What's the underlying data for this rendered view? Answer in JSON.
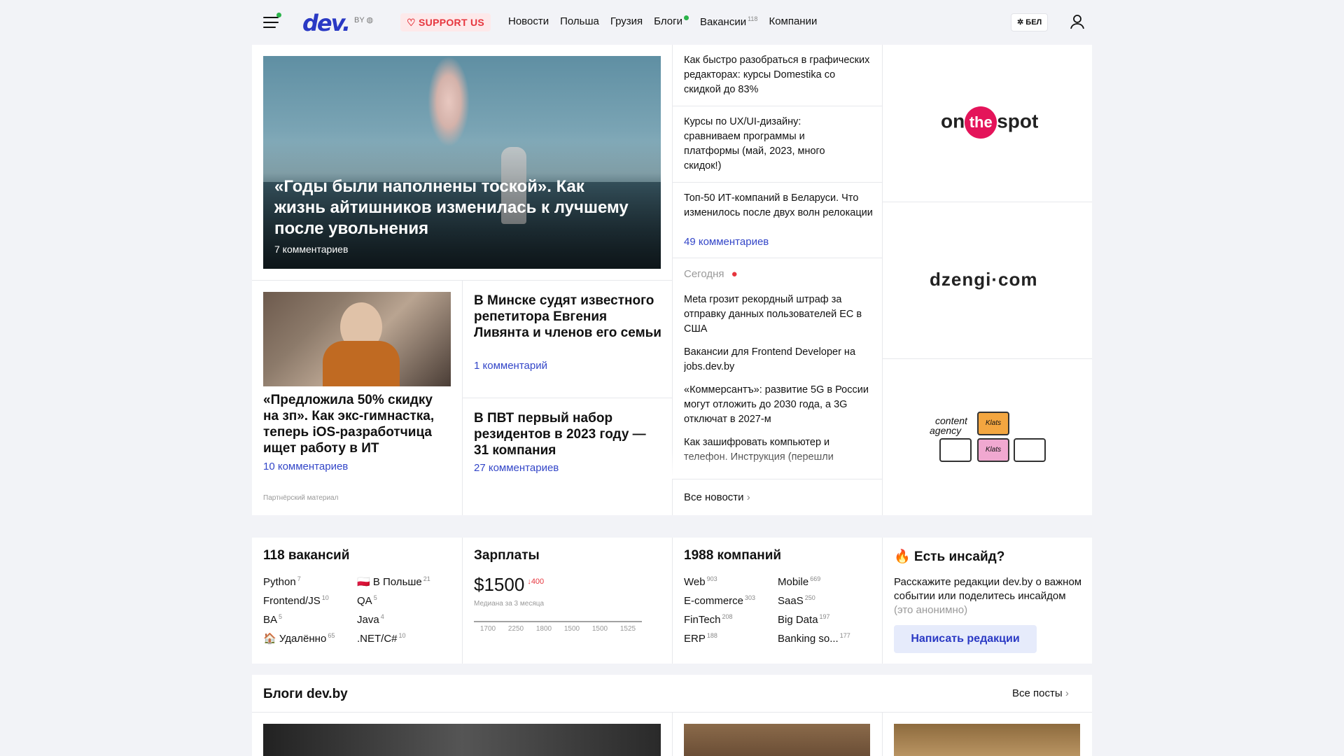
{
  "header": {
    "logo": "dev.",
    "region": "BY",
    "support": "♡ SUPPORT US",
    "nav": [
      {
        "label": "Новости"
      },
      {
        "label": "Польша"
      },
      {
        "label": "Грузия"
      },
      {
        "label": "Блоги",
        "dot": true
      },
      {
        "label": "Вакансии",
        "count": "118"
      },
      {
        "label": "Компании"
      }
    ],
    "lang": "БЕЛ"
  },
  "hero": {
    "title": "«Годы были наполнены тоской». Как жизнь айтишников изменилась к лучшему после увольнения",
    "comments": "7 комментариев"
  },
  "story_left": {
    "title": "«Предложила 50% скидку на зп». Как экс-гимнастка, теперь iOS-разработчица ищет работу в ИТ",
    "comments": "10 комментариев",
    "partner": "Партнёрский материал"
  },
  "story_mid1": {
    "title": "В Минске судят известного репетитора Евгения Ливянта и членов его семьи",
    "comments": "1 комментарий"
  },
  "story_mid2": {
    "title": "В ПВТ первый набор резидентов в 2023 году — 31 компания",
    "comments": "27 комментариев"
  },
  "side_top": [
    {
      "title": "Как быстро разобраться в графических редакторах: курсы Domestika со скидкой до 83%"
    },
    {
      "title": "Курсы по UX/UI-дизайну: сравниваем программы и платформы (май, 2023, много скидок!)"
    },
    {
      "title": "Топ-50 ИТ-компаний в Беларуси. Что изменилось после двух волн релокации",
      "comments": "49 комментариев"
    }
  ],
  "today": {
    "label": "Сегодня",
    "items": [
      "Meta грозит рекордный штраф за отправку данных пользователей ЕС в США",
      "Вакансии для Frontend Developer на jobs.dev.by",
      "«Коммерсантъ»: развитие 5G в России могут отложить до 2030 года, а 3G отключат в 2027-м",
      "Как зашифровать компьютер и телефон. Инструкция (перешли"
    ],
    "all_news": "Все новости"
  },
  "ads": {
    "a1": {
      "pre": "on",
      "mid": "the",
      "post": "spot"
    },
    "a2": "dzengi·com",
    "a3": {
      "line1": "content",
      "line2": "agency",
      "brand": "Klats"
    }
  },
  "vacancies": {
    "title": "118 вакансий",
    "tags": [
      {
        "label": "Python",
        "count": "7"
      },
      {
        "label": "🇵🇱 В Польше",
        "count": "21"
      },
      {
        "label": "Frontend/JS",
        "count": "10"
      },
      {
        "label": "QA",
        "count": "5"
      },
      {
        "label": "BA",
        "count": "5"
      },
      {
        "label": "Java",
        "count": "4"
      },
      {
        "label": "🏠 Удалённо",
        "count": "65"
      },
      {
        "label": ".NET/C#",
        "count": "10"
      }
    ]
  },
  "salaries": {
    "title": "Зарплаты",
    "value": "$1500",
    "delta": "↓400",
    "caption": "Медиана за 3 месяца"
  },
  "chart_data": {
    "type": "line",
    "title": "",
    "categories": [
      "1700",
      "2250",
      "1800",
      "1500",
      "1500",
      "1525"
    ],
    "values": [
      1700,
      2250,
      1800,
      1500,
      1500,
      1525
    ]
  },
  "companies": {
    "title": "1988 компаний",
    "tags": [
      {
        "label": "Web",
        "count": "903"
      },
      {
        "label": "Mobile",
        "count": "669"
      },
      {
        "label": "E-commerce",
        "count": "303"
      },
      {
        "label": "SaaS",
        "count": "250"
      },
      {
        "label": "FinTech",
        "count": "208"
      },
      {
        "label": "Big Data",
        "count": "197"
      },
      {
        "label": "ERP",
        "count": "188"
      },
      {
        "label": "Banking so...",
        "count": "177"
      }
    ]
  },
  "insider": {
    "title": "🔥 Есть инсайд?",
    "text": "Расскажите редакции dev.by о важном событии или поделитесь инсайдом",
    "anon": "(это анонимно)",
    "button": "Написать редакции"
  },
  "blogs": {
    "title": "Блоги dev.by",
    "all": "Все посты"
  },
  "colors": {
    "accent": "#2a39c4",
    "red": "#e6353d",
    "green": "#2bb34a",
    "bg": "#f2f3f7"
  }
}
